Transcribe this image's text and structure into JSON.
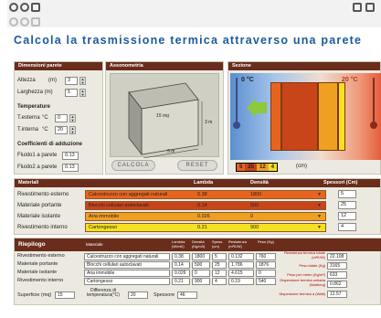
{
  "window": {
    "title": "Calcola la trasmissione termica attraverso una parete"
  },
  "dimensioni": {
    "header": "Dimensioni parete",
    "altezza_label": "Altezza",
    "altezza_unit": "(m)",
    "altezza_value": "3",
    "larghezza_label": "Larghezza (m)",
    "larghezza_value": "5",
    "temperature_header": "Temperature",
    "t_esterna_label": "T.esterna",
    "t_esterna_unit": "°C",
    "t_esterna_value": "0",
    "t_interna_label": "T.interna",
    "t_interna_unit": "°C",
    "t_interna_value": "20",
    "coeff_header": "Coefficienti di adduzione",
    "fluido1_label": "Fluido1 a parete",
    "fluido1_value": "0.13",
    "fluido2_label": "Fluido2 a parete",
    "fluido2_value": "0.13"
  },
  "assonometria": {
    "header": "Assonometria",
    "area_label": "15 mq",
    "height_label": "3 m",
    "width_label": "5 m",
    "calcola_button": "CALCOLA",
    "reset_button": "RESET"
  },
  "sezione": {
    "header": "Sezione",
    "temp_left": "0 °C",
    "temp_right": "20 °C",
    "thickness_values": [
      "5",
      "25",
      "12",
      "4"
    ],
    "unit": "(cm)",
    "layer_colors": [
      "#e8641e",
      "#c8451a",
      "#f0a020",
      "#f6e020"
    ]
  },
  "materiali": {
    "header": "Materiali",
    "col_lambda": "Lambda",
    "col_densita": "Densità",
    "col_spessori": "Spessori (Cm)",
    "rows": [
      {
        "label": "Rivestimento esterno",
        "material": "Calcestruzzo con aggregati naturali",
        "lambda": "0.38",
        "densita": "1800",
        "spessore": "5",
        "color": "#e8641e"
      },
      {
        "label": "Materiale portante",
        "material": "Blocchi cellulari autoclavati",
        "lambda": "0.14",
        "densita": "500",
        "spessore": "25",
        "color": "#c8451a"
      },
      {
        "label": "Materiale isolante",
        "material": "Aria immobile",
        "lambda": "0.026",
        "densita": "0",
        "spessore": "12",
        "color": "#f0a020"
      },
      {
        "label": "Rivestimento interno",
        "material": "Cartongesso",
        "lambda": "0.21",
        "densita": "900",
        "spessore": "4",
        "color": "#f6e020"
      }
    ]
  },
  "riepilogo": {
    "header": "Riepilogo",
    "col_materiale": "Materiale",
    "col_lambda": "Lambda (W/mK)",
    "col_densita": "Densità (Kg/m3)",
    "col_spessore": "Spess. (cm)",
    "col_resistenza": "Resistenza (m²K/W)",
    "col_peso": "Peso (Kg)",
    "rows": [
      {
        "label": "Rivestimento esterno",
        "materiale": "Calcestruzzo con aggregati naturali",
        "lambda": "0.38",
        "densita": "1800",
        "spessore": "5",
        "resistenza": "0.132",
        "peso": "760"
      },
      {
        "label": "Materiale portante",
        "materiale": "Blocchi cellulari autoclavati",
        "lambda": "0.14",
        "densita": "500",
        "spessore": "25",
        "resistenza": "1.786",
        "peso": "1876"
      },
      {
        "label": "Materiale isolante",
        "materiale": "Aria immobile",
        "lambda": "0.026",
        "densita": "0",
        "spessore": "12",
        "resistenza": "4.615",
        "peso": "0"
      },
      {
        "label": "Rivestimento interno",
        "materiale": "Cartongesso",
        "lambda": "0.21",
        "densita": "900",
        "spessore": "4",
        "resistenza": "0.19",
        "peso": "540"
      }
    ],
    "superficie_label": "Superficie (mq)",
    "superficie_value": "15",
    "diff_temp_label": "Differenza di temperatura(°C)",
    "diff_temp_value": "20",
    "spessore_label": "Spessore",
    "spessore_value": "46",
    "res_tot_label": "Resistenza termica totale (m²K/W)",
    "res_tot_value": "22.108",
    "peso_tot_label": "Peso totale (Kg)",
    "peso_tot_value": "3165",
    "peso_mq_label": "Peso per metro (Kg/m²)",
    "peso_mq_value": "633",
    "disp_unit_label": "Dispersione termica unitaria (Watt/mq)",
    "disp_unit_value": "0.862",
    "disp_tot_label": "Dispersione termica a (Watt)",
    "disp_tot_value": "12.57"
  }
}
